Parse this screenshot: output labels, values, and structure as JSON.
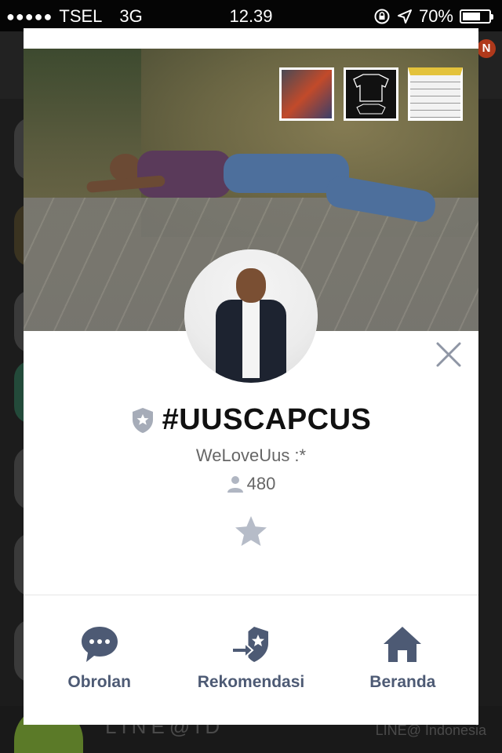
{
  "status_bar": {
    "signal": "●●●●●",
    "carrier": "TSEL",
    "network": "3G",
    "time": "12.39",
    "battery": "70%",
    "battery_level": 0.7
  },
  "background": {
    "badge": "N",
    "bottom_name": "LINE@ID",
    "bottom_sub": "LINE@ Indonesia"
  },
  "profile": {
    "name": "#UUSCAPCUS",
    "status_message": "WeLoveUus :*",
    "member_count": "480"
  },
  "actions": [
    {
      "label": "Obrolan",
      "icon": "chat-bubble-icon"
    },
    {
      "label": "Rekomendasi",
      "icon": "recommend-icon"
    },
    {
      "label": "Beranda",
      "icon": "home-icon"
    }
  ],
  "colors": {
    "accent": "#4d5a74",
    "icon_gray": "#b6bcc8"
  }
}
